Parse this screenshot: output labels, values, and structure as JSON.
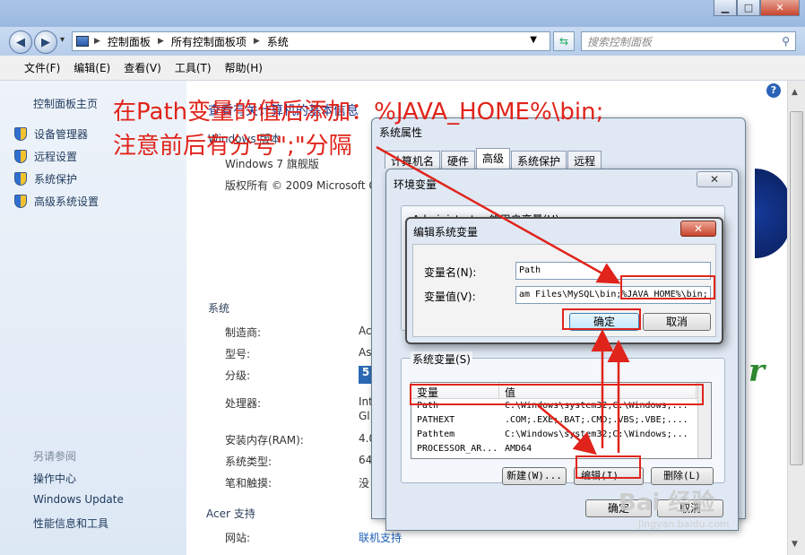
{
  "window": {
    "minimize": "▁",
    "maximize": "□",
    "close": "✕"
  },
  "nav": {
    "back": "◀",
    "forward": "▶",
    "dropdown": "▾",
    "breadcrumb": [
      "控制面板",
      "所有控制面板项",
      "系统"
    ],
    "search_placeholder": "搜索控制面板"
  },
  "menu": [
    "文件(F)",
    "编辑(E)",
    "查看(V)",
    "工具(T)",
    "帮助(H)"
  ],
  "left_pane": {
    "home": "控制面板主页",
    "tasks": [
      "设备管理器",
      "远程设置",
      "系统保护",
      "高级系统设置"
    ],
    "see_also": "另请参阅",
    "links": [
      "操作中心",
      "Windows Update",
      "性能信息和工具"
    ]
  },
  "content": {
    "heading": "查看有关计算机的基本信息",
    "edition_section": "Windows 版本",
    "edition": "Windows 7 旗舰版",
    "copyright": "版权所有 © 2009 Microsoft C",
    "system_section": "系统",
    "labels": [
      "制造商:",
      "型号:",
      "分级:",
      "处理器:",
      "安装内存(RAM):",
      "系统类型:",
      "笔和触摸:"
    ],
    "values": [
      "Ac",
      "As",
      "5",
      "Int",
      "Gl",
      "4.0",
      "64",
      "没"
    ],
    "support_section": "Acer 支持",
    "website_label": "网站:",
    "website_link": "联机支持"
  },
  "sys_props": {
    "title": "系统属性",
    "tabs": [
      "计算机名",
      "硬件",
      "高级",
      "系统保护",
      "远程"
    ],
    "active_tab": "高级",
    "ok": "确定",
    "cancel": "取消"
  },
  "env_vars": {
    "title": "环境变量",
    "close": "✕",
    "user_group": "Administrator 的用户变量(U)",
    "system_group": "系统变量(S)",
    "col_var": "变量",
    "col_val": "值",
    "rows": [
      {
        "name": "Path",
        "value": "C:\\Windows\\system32;C:\\Windows;..."
      },
      {
        "name": "PATHEXT",
        "value": ".COM;.EXE;.BAT;.CMD;.VBS;.VBE;...."
      },
      {
        "name": "Pathtem",
        "value": "C:\\Windows\\system32;C:\\Windows;..."
      },
      {
        "name": "PROCESSOR_AR...",
        "value": "AMD64"
      }
    ],
    "new_btn": "新建(W)...",
    "edit_btn": "编辑(I)...",
    "delete_btn": "删除(L)"
  },
  "edit_var": {
    "title": "编辑系统变量",
    "close": "✕",
    "name_label": "变量名(N):",
    "value_label": "变量值(V):",
    "name_value": "Path",
    "value_value": "am Files\\MySQL\\bin;%JAVA_HOME%\\bin;",
    "ok": "确定",
    "cancel": "取消"
  },
  "annotation": {
    "line1": "在Path变量的值后添加：%JAVA_HOME%\\bin;",
    "line2": "注意前后有分号\";\"分隔",
    "color": "#e0241b"
  },
  "watermark": {
    "logo": "Bai 经验",
    "url": "jingyan.baidu.com"
  }
}
